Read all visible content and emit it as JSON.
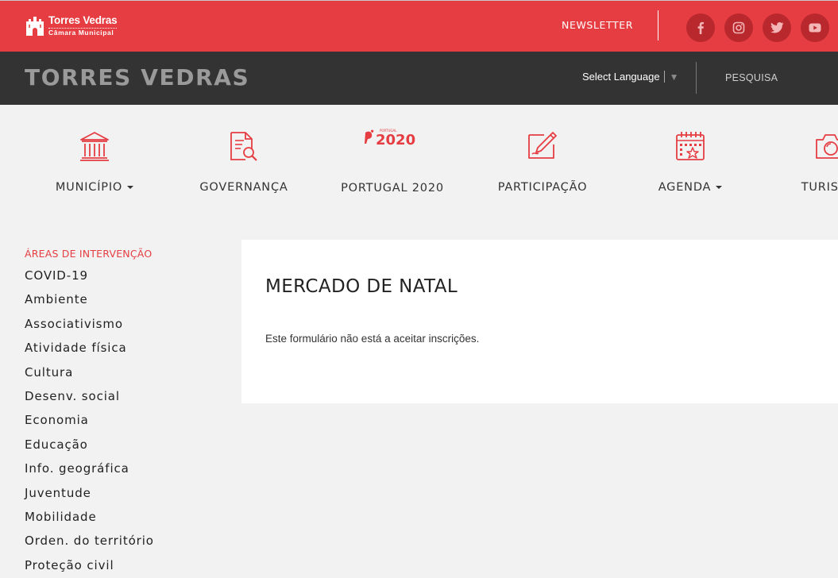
{
  "topbar": {
    "logo": {
      "name": "Torres Vedras",
      "subtitle": "Câmara Municipal"
    },
    "newsletter_label": "NEWSLETTER",
    "social": [
      "facebook-icon",
      "instagram-icon",
      "twitter-icon",
      "youtube-icon"
    ]
  },
  "header": {
    "site_title": "TORRES VEDRAS",
    "language_label": "Select Language",
    "search_label": "PESQUISA"
  },
  "nav": {
    "items": [
      {
        "label": "MUNICÍPIO",
        "icon": "building-columns-icon",
        "dropdown": true
      },
      {
        "label": "GOVERNANÇA",
        "icon": "document-search-icon",
        "dropdown": false
      },
      {
        "label": "PORTUGAL 2020",
        "icon": "portugal-2020-logo",
        "dropdown": false,
        "logo_small": "PORTUGAL",
        "logo_big": "2020"
      },
      {
        "label": "PARTICIPAÇÃO",
        "icon": "pencil-paper-icon",
        "dropdown": false
      },
      {
        "label": "AGENDA",
        "icon": "calendar-star-icon",
        "dropdown": true
      },
      {
        "label": "TURISMO",
        "icon": "camera-icon",
        "dropdown": false
      }
    ]
  },
  "sidebar": {
    "heading": "ÁREAS DE INTERVENÇÃO",
    "items": [
      "COVID-19",
      "Ambiente",
      "Associativismo",
      "Atividade física",
      "Cultura",
      "Desenv. social",
      "Economia",
      "Educação",
      "Info. geográfica",
      "Juventude",
      "Mobilidade",
      "Orden. do território",
      "Proteção civil"
    ]
  },
  "main": {
    "title": "MERCADO DE NATAL",
    "notice": "Este formulário não está a aceitar inscrições."
  },
  "colors": {
    "brand_red": "#e53d42",
    "dark_bar": "#333333",
    "social_circle": "#b8282d"
  }
}
